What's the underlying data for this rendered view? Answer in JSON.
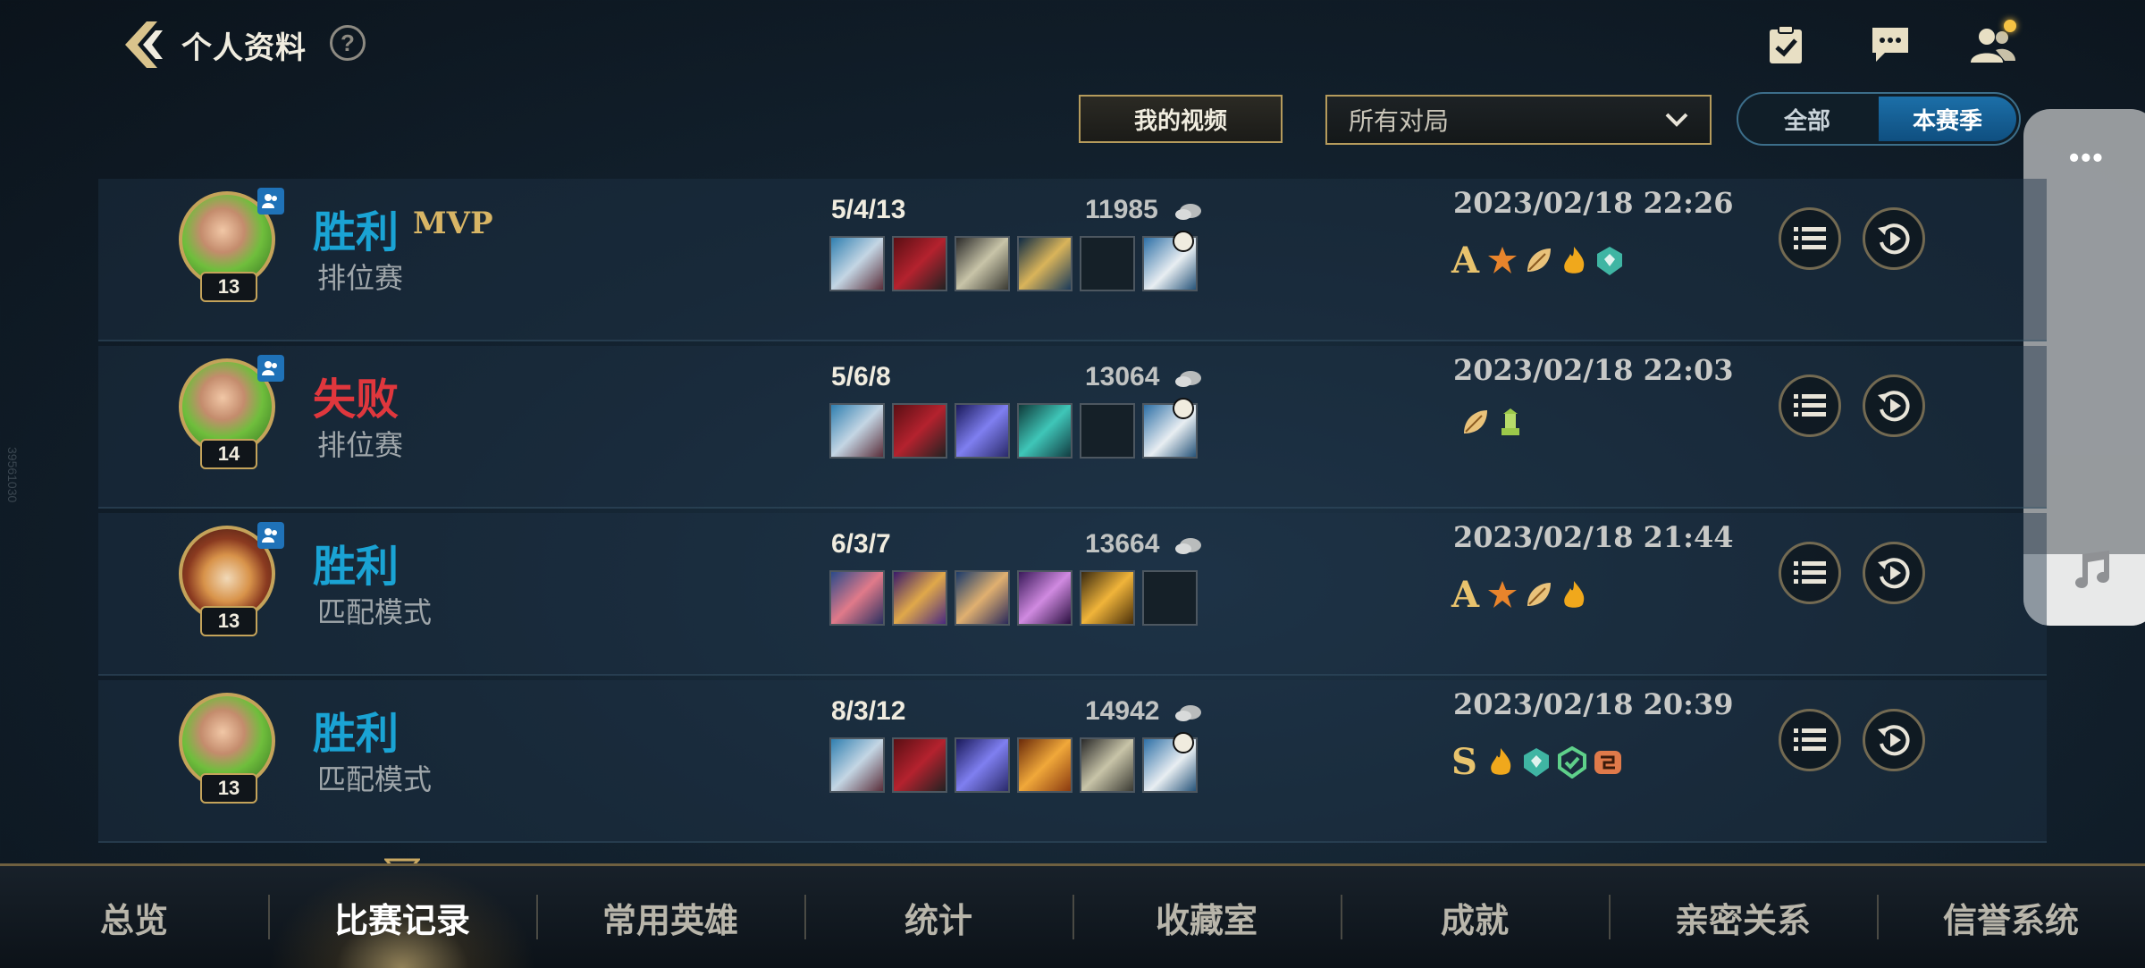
{
  "header": {
    "title": "个人资料",
    "help": "?"
  },
  "filters": {
    "video_button": "我的视频",
    "match_select_value": "所有对局",
    "season_options": [
      "全部",
      "本赛季"
    ],
    "season_selected": "本赛季"
  },
  "side_panel": {
    "menu_glyph": "•••"
  },
  "watermark": "39561030",
  "matches": [
    {
      "result": "胜利",
      "outcome": "win",
      "mvp": "MVP",
      "mode": "排位赛",
      "level": "13",
      "kda": "5/4/13",
      "gold": "11985",
      "date": "2023/02/18 22:26",
      "grade": "A"
    },
    {
      "result": "失败",
      "outcome": "lose",
      "mvp": "",
      "mode": "排位赛",
      "level": "14",
      "kda": "5/6/8",
      "gold": "13064",
      "date": "2023/02/18 22:03",
      "grade": ""
    },
    {
      "result": "胜利",
      "outcome": "win",
      "mvp": "",
      "mode": "匹配模式",
      "level": "13",
      "kda": "6/3/7",
      "gold": "13664",
      "date": "2023/02/18 21:44",
      "grade": "A"
    },
    {
      "result": "胜利",
      "outcome": "win",
      "mvp": "",
      "mode": "匹配模式",
      "level": "13",
      "kda": "8/3/12",
      "gold": "14942",
      "date": "2023/02/18 20:39",
      "grade": "S"
    }
  ],
  "nav": {
    "items": [
      "总览",
      "比赛记录",
      "常用英雄",
      "统计",
      "收藏室",
      "成就",
      "亲密关系",
      "信誉系统"
    ],
    "active": "比赛记录"
  },
  "colors": {
    "win": "#1aa3d4",
    "lose": "#e0373d",
    "gold_accent": "#c4a35a",
    "toggle_active": "#1c6fa8"
  }
}
